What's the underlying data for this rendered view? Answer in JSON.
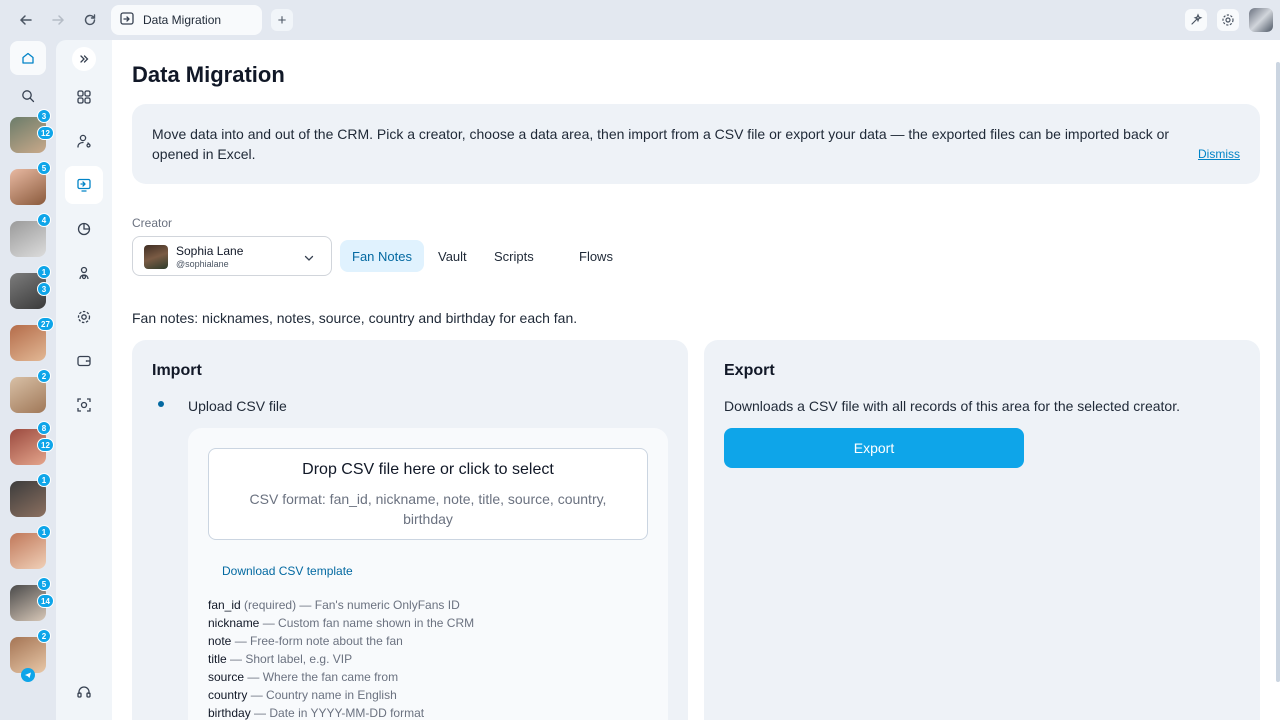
{
  "browser": {
    "tab_title": "Data Migration",
    "new_tab_symbol": "+"
  },
  "rail": {
    "creators": [
      {
        "badges": [
          "3",
          "12"
        ],
        "colors": [
          "#6b7c6a",
          "#c9a98a"
        ]
      },
      {
        "badges": [
          "5"
        ],
        "colors": [
          "#e8b9a2",
          "#8a5a3c"
        ]
      },
      {
        "badges": [
          "4"
        ],
        "colors": [
          "#9a9a9a",
          "#dcdcdc"
        ]
      },
      {
        "badges": [
          "1",
          "3"
        ],
        "colors": [
          "#7c7c7c",
          "#3a3a3a"
        ]
      },
      {
        "badges": [
          "27"
        ],
        "colors": [
          "#b46c4a",
          "#e2b895"
        ]
      },
      {
        "badges": [
          "2"
        ],
        "colors": [
          "#d8c0a6",
          "#a07858"
        ]
      },
      {
        "badges": [
          "8",
          "12"
        ],
        "colors": [
          "#9b4a3f",
          "#e4a58c"
        ]
      },
      {
        "badges": [
          "1"
        ],
        "colors": [
          "#3c3c3c",
          "#8c7060"
        ]
      },
      {
        "badges": [
          "1"
        ],
        "colors": [
          "#c0785a",
          "#f0d0b8"
        ]
      },
      {
        "badges": [
          "5",
          "14"
        ],
        "colors": [
          "#4a4a4a",
          "#d8c8b8"
        ]
      },
      {
        "badges": [
          "2"
        ],
        "colors": [
          "#a47454",
          "#e8c8a8"
        ]
      }
    ]
  },
  "sidebar": {
    "items": [
      {
        "name": "dashboard-icon"
      },
      {
        "name": "users-icon"
      },
      {
        "name": "data-migration-icon",
        "active": true
      },
      {
        "name": "analytics-icon"
      },
      {
        "name": "team-icon"
      },
      {
        "name": "settings-icon"
      },
      {
        "name": "wallet-icon"
      },
      {
        "name": "ai-icon"
      }
    ]
  },
  "page": {
    "title": "Data Migration",
    "info_text": "Move data into and out of the CRM. Pick a creator, choose a data area, then import from a CSV file or export your data — the exported files can be imported back or opened in Excel.",
    "dismiss_label": "Dismiss",
    "creator_label": "Creator",
    "creator": {
      "name": "Sophia Lane",
      "handle": "@sophialane"
    },
    "tabs": [
      "Fan Notes",
      "Vault",
      "Scripts",
      "Flows"
    ],
    "active_tab": "Fan Notes",
    "area_description": "Fan notes: nicknames, notes, source, country and birthday for each fan."
  },
  "import": {
    "title": "Import",
    "option_label": "Upload CSV file",
    "dropzone_title": "Drop CSV file here or click to select",
    "dropzone_format": "CSV format: fan_id, nickname, note, title, source, country, birthday",
    "template_link": "Download CSV template",
    "fields": [
      {
        "key": "fan_id",
        "desc": "(required) — Fan's numeric OnlyFans ID"
      },
      {
        "key": "nickname",
        "desc": "— Custom fan name shown in the CRM"
      },
      {
        "key": "note",
        "desc": "— Free-form note about the fan"
      },
      {
        "key": "title",
        "desc": "— Short label, e.g. VIP"
      },
      {
        "key": "source",
        "desc": "— Where the fan came from"
      },
      {
        "key": "country",
        "desc": "— Country name in English"
      },
      {
        "key": "birthday",
        "desc": "— Date in YYYY-MM-DD format"
      }
    ]
  },
  "export": {
    "title": "Export",
    "description": "Downloads a CSV file with all records of this area for the selected creator.",
    "button_label": "Export"
  },
  "colors": {
    "accent": "#0ea5e9",
    "accent_dark": "#0369a1",
    "panel_bg": "#eef2f7"
  }
}
